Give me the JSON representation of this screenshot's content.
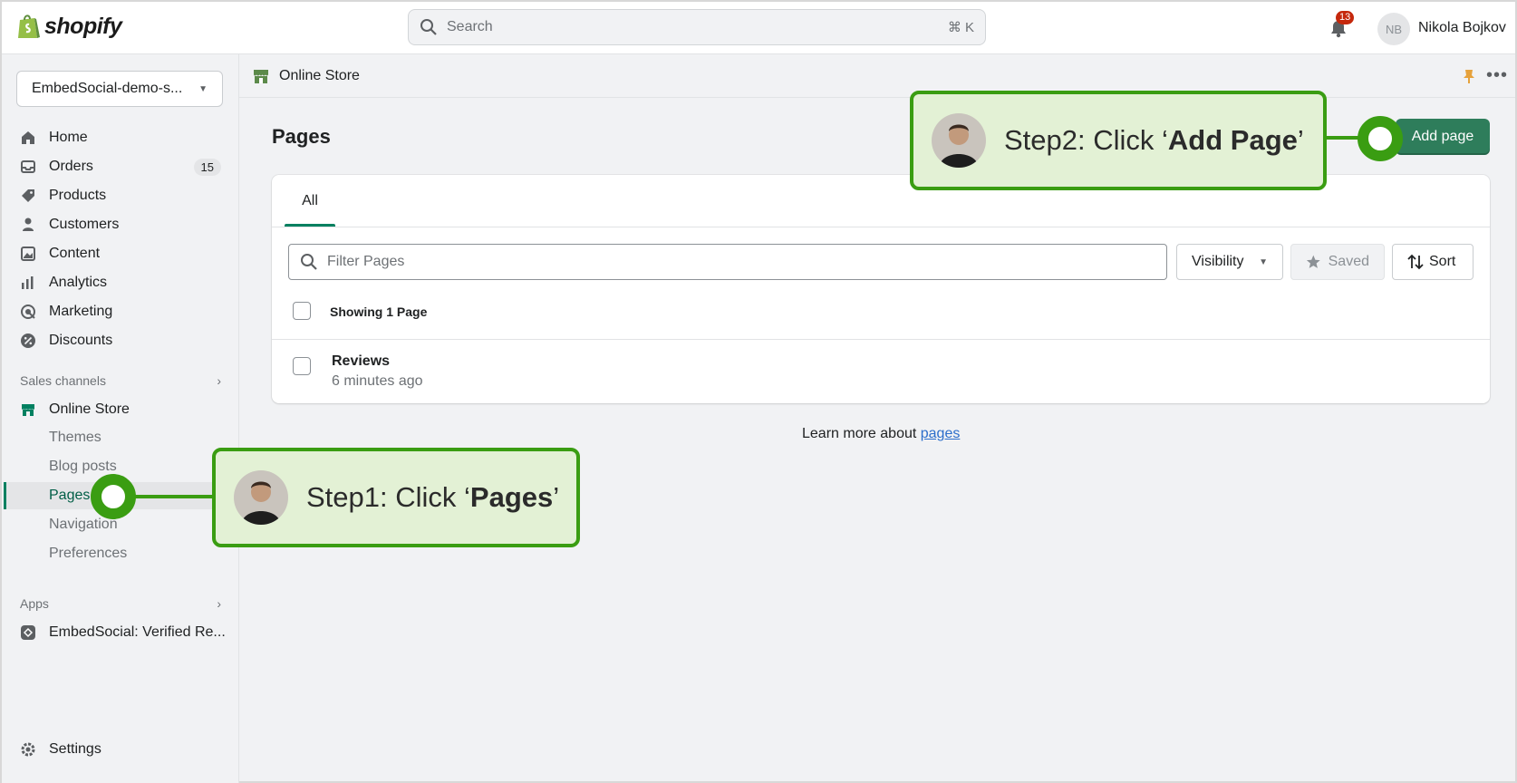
{
  "brand": {
    "name": "shopify"
  },
  "search": {
    "placeholder": "Search",
    "shortcut": "⌘ K"
  },
  "notifications": {
    "count": "13"
  },
  "user": {
    "initials": "NB",
    "name": "Nikola Bojkov"
  },
  "sidebar": {
    "store": "EmbedSocial-demo-s...",
    "items": [
      {
        "label": "Home",
        "icon": "home-icon"
      },
      {
        "label": "Orders",
        "icon": "orders-icon",
        "badge": "15"
      },
      {
        "label": "Products",
        "icon": "tag-icon"
      },
      {
        "label": "Customers",
        "icon": "person-icon"
      },
      {
        "label": "Content",
        "icon": "content-icon"
      },
      {
        "label": "Analytics",
        "icon": "bar-chart-icon"
      },
      {
        "label": "Marketing",
        "icon": "target-icon"
      },
      {
        "label": "Discounts",
        "icon": "discount-icon"
      }
    ],
    "sales_channels_label": "Sales channels",
    "online_store": "Online Store",
    "sub_items": [
      "Themes",
      "Blog posts",
      "Pages",
      "Navigation",
      "Preferences"
    ],
    "apps_label": "Apps",
    "app_item": "EmbedSocial: Verified Re...",
    "settings": "Settings"
  },
  "header": {
    "section": "Online Store"
  },
  "main": {
    "title": "Pages",
    "add_button": "Add page",
    "tab_all": "All",
    "filter_placeholder": "Filter Pages",
    "visibility": "Visibility",
    "saved": "Saved",
    "sort": "Sort",
    "showing": "Showing 1 Page",
    "rows": [
      {
        "title": "Reviews",
        "subtitle": "6 minutes ago"
      }
    ],
    "learn_prefix": "Learn more about ",
    "learn_link": "pages"
  },
  "callouts": {
    "step1_prefix": "Step1: Click ‘",
    "step1_bold": "Pages",
    "step1_suffix": "’",
    "step2_prefix": "Step2: Click ‘",
    "step2_bold": "Add Page",
    "step2_suffix": "’"
  },
  "colors": {
    "accent": "#008060",
    "callout_green": "#3a9d12",
    "callout_bg": "#e3f1d5",
    "primary_button": "#2e7d5b"
  }
}
